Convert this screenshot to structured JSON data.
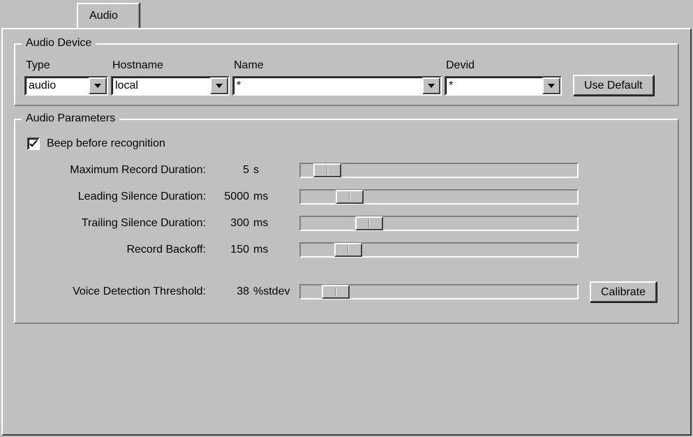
{
  "tab": {
    "label": "Audio"
  },
  "device": {
    "legend": "Audio Device",
    "labels": {
      "type": "Type",
      "hostname": "Hostname",
      "name": "Name",
      "devid": "Devid"
    },
    "values": {
      "type": "audio",
      "hostname": "local",
      "name": "*",
      "devid": "*"
    },
    "use_default_label": "Use Default"
  },
  "params": {
    "legend": "Audio Parameters",
    "beep": {
      "label": "Beep before recognition",
      "checked": true
    },
    "rows": {
      "max_record": {
        "label": "Maximum Record Duration:",
        "value": "5",
        "unit": "s",
        "pos": 18
      },
      "lead_silence": {
        "label": "Leading Silence Duration:",
        "value": "5000",
        "unit": "ms",
        "pos": 50
      },
      "trail_silence": {
        "label": "Trailing Silence Duration:",
        "value": "300",
        "unit": "ms",
        "pos": 78
      },
      "record_backoff": {
        "label": "Record Backoff:",
        "value": "150",
        "unit": "ms",
        "pos": 48
      },
      "vdt": {
        "label": "Voice Detection Threshold:",
        "value": "38",
        "unit": "%stdev",
        "pos": 30
      }
    },
    "calibrate_label": "Calibrate"
  }
}
